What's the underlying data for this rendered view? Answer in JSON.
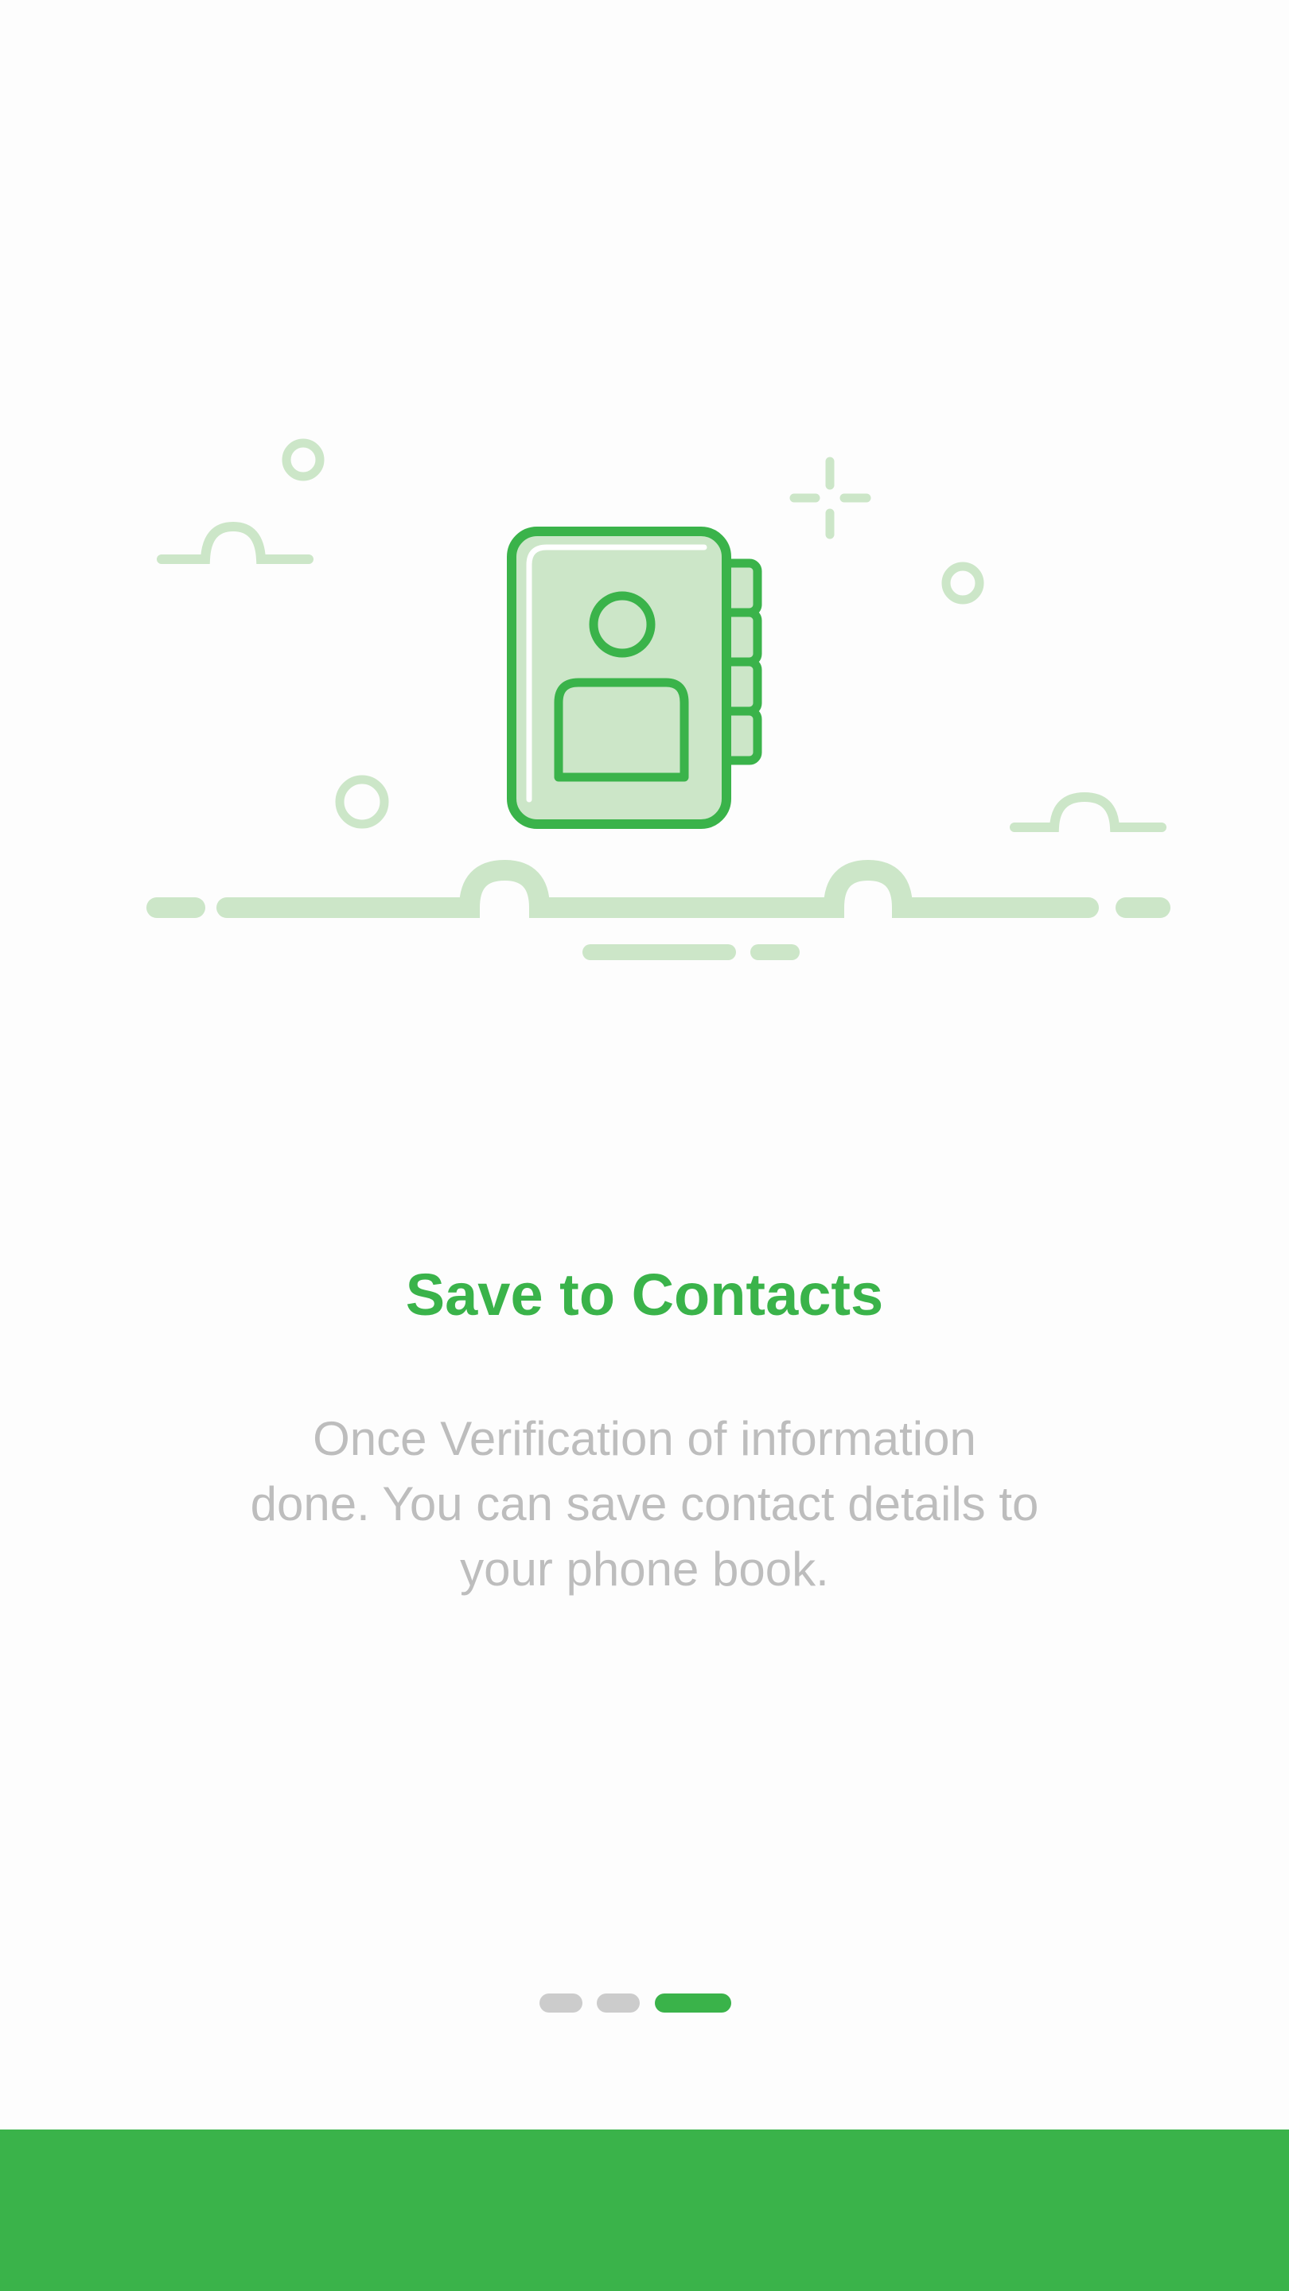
{
  "onboarding": {
    "title": "Save to Contacts",
    "description": "Once Verification of information done. You can save contact details to your phone book.",
    "illustration_icon": "contact-book-icon",
    "page_indicator": {
      "total": 3,
      "active": 3
    }
  },
  "colors": {
    "accent": "#3ab34a",
    "accent_light": "#cce6c8",
    "text_muted": "#bdbdbd",
    "indicator_inactive": "#cccccc",
    "background": "#fdfdfd"
  }
}
